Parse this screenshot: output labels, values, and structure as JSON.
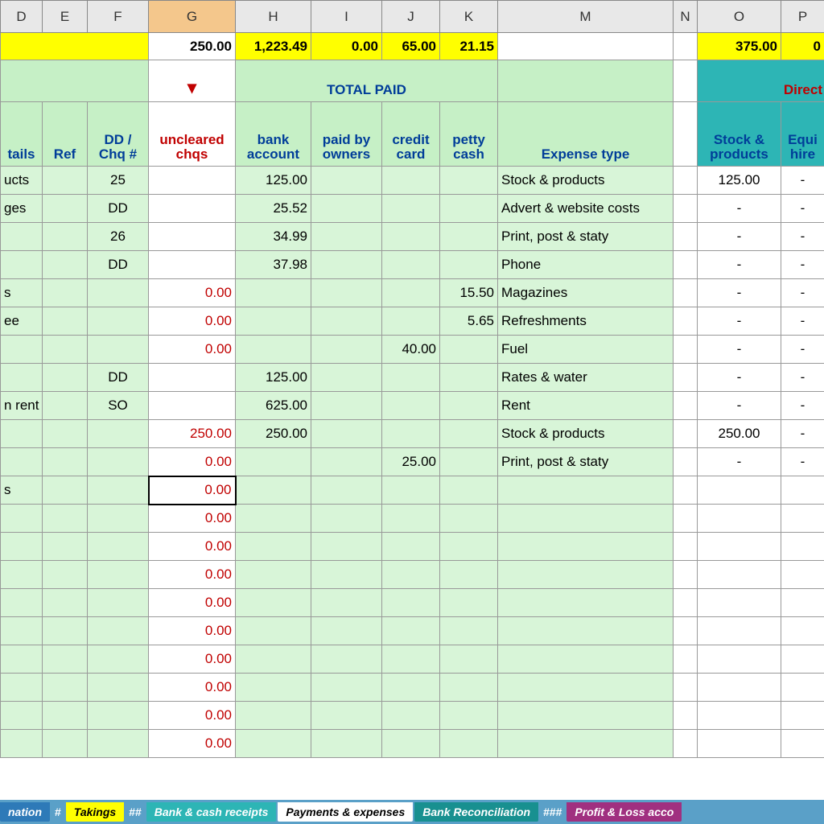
{
  "columns": [
    "D",
    "E",
    "F",
    "G",
    "H",
    "I",
    "J",
    "K",
    "M",
    "N",
    "O",
    "P"
  ],
  "totals": {
    "G": "250.00",
    "H": "1,223.49",
    "I": "0.00",
    "J": "65.00",
    "K": "21.15",
    "O": "375.00",
    "P": "0"
  },
  "section_titles": {
    "total_paid": "TOTAL PAID",
    "direct": "Direct"
  },
  "headers2": {
    "D": "tails",
    "E": "Ref",
    "F": "DD / Chq #",
    "G": "uncleared chqs",
    "H": "bank account",
    "I": "paid by owners",
    "J": "credit card",
    "K": "petty cash",
    "M": "Expense type",
    "O": "Stock & products",
    "P": "Equi hire"
  },
  "rows": [
    {
      "D": "ucts",
      "E": "",
      "F": "25",
      "G": "",
      "H": "125.00",
      "I": "",
      "J": "",
      "K": "",
      "M": "Stock & products",
      "O": "125.00",
      "P": "-"
    },
    {
      "D": "ges",
      "E": "",
      "F": "DD",
      "G": "",
      "H": "25.52",
      "I": "",
      "J": "",
      "K": "",
      "M": "Advert & website costs",
      "O": "-",
      "P": "-"
    },
    {
      "D": "",
      "E": "",
      "F": "26",
      "G": "",
      "H": "34.99",
      "I": "",
      "J": "",
      "K": "",
      "M": "Print, post & staty",
      "O": "-",
      "P": "-"
    },
    {
      "D": "",
      "E": "",
      "F": "DD",
      "G": "",
      "H": "37.98",
      "I": "",
      "J": "",
      "K": "",
      "M": "Phone",
      "O": "-",
      "P": "-"
    },
    {
      "D": "s",
      "E": "",
      "F": "",
      "G": "0.00",
      "H": "",
      "I": "",
      "J": "",
      "K": "15.50",
      "M": "Magazines",
      "O": "-",
      "P": "-"
    },
    {
      "D": "ee",
      "E": "",
      "F": "",
      "G": "0.00",
      "H": "",
      "I": "",
      "J": "",
      "K": "5.65",
      "M": "Refreshments",
      "O": "-",
      "P": "-"
    },
    {
      "D": "",
      "E": "",
      "F": "",
      "G": "0.00",
      "H": "",
      "I": "",
      "J": "40.00",
      "K": "",
      "M": "Fuel",
      "O": "-",
      "P": "-"
    },
    {
      "D": "",
      "E": "",
      "F": "DD",
      "G": "",
      "H": "125.00",
      "I": "",
      "J": "",
      "K": "",
      "M": "Rates & water",
      "O": "-",
      "P": "-"
    },
    {
      "D": "n rent",
      "E": "",
      "F": "SO",
      "G": "",
      "H": "625.00",
      "I": "",
      "J": "",
      "K": "",
      "M": "Rent",
      "O": "-",
      "P": "-"
    },
    {
      "D": "",
      "E": "",
      "F": "",
      "G": "250.00",
      "H": "250.00",
      "I": "",
      "J": "",
      "K": "",
      "M": "Stock & products",
      "O": "250.00",
      "P": "-"
    },
    {
      "D": "",
      "E": "",
      "F": "",
      "G": "0.00",
      "H": "",
      "I": "",
      "J": "25.00",
      "K": "",
      "M": "Print, post & staty",
      "O": "-",
      "P": "-"
    },
    {
      "D": "s",
      "E": "",
      "F": "",
      "G": "0.00",
      "H": "",
      "I": "",
      "J": "",
      "K": "",
      "M": "",
      "O": "",
      "P": "",
      "selected": true
    },
    {
      "D": "",
      "E": "",
      "F": "",
      "G": "0.00",
      "H": "",
      "I": "",
      "J": "",
      "K": "",
      "M": "",
      "O": "",
      "P": ""
    },
    {
      "D": "",
      "E": "",
      "F": "",
      "G": "0.00",
      "H": "",
      "I": "",
      "J": "",
      "K": "",
      "M": "",
      "O": "",
      "P": ""
    },
    {
      "D": "",
      "E": "",
      "F": "",
      "G": "0.00",
      "H": "",
      "I": "",
      "J": "",
      "K": "",
      "M": "",
      "O": "",
      "P": ""
    },
    {
      "D": "",
      "E": "",
      "F": "",
      "G": "0.00",
      "H": "",
      "I": "",
      "J": "",
      "K": "",
      "M": "",
      "O": "",
      "P": ""
    },
    {
      "D": "",
      "E": "",
      "F": "",
      "G": "0.00",
      "H": "",
      "I": "",
      "J": "",
      "K": "",
      "M": "",
      "O": "",
      "P": ""
    },
    {
      "D": "",
      "E": "",
      "F": "",
      "G": "0.00",
      "H": "",
      "I": "",
      "J": "",
      "K": "",
      "M": "",
      "O": "",
      "P": ""
    },
    {
      "D": "",
      "E": "",
      "F": "",
      "G": "0.00",
      "H": "",
      "I": "",
      "J": "",
      "K": "",
      "M": "",
      "O": "",
      "P": ""
    },
    {
      "D": "",
      "E": "",
      "F": "",
      "G": "0.00",
      "H": "",
      "I": "",
      "J": "",
      "K": "",
      "M": "",
      "O": "",
      "P": ""
    },
    {
      "D": "",
      "E": "",
      "F": "",
      "G": "0.00",
      "H": "",
      "I": "",
      "J": "",
      "K": "",
      "M": "",
      "O": "",
      "P": ""
    }
  ],
  "tabs": [
    {
      "label": "nation",
      "cls": "blue"
    },
    {
      "label": "#",
      "cls": "hash"
    },
    {
      "label": "Takings",
      "cls": "yellow"
    },
    {
      "label": "##",
      "cls": "hash"
    },
    {
      "label": "Bank & cash receipts",
      "cls": "teal1"
    },
    {
      "label": "Payments & expenses",
      "cls": "active"
    },
    {
      "label": "Bank Reconciliation",
      "cls": "teal2"
    },
    {
      "label": "###",
      "cls": "hash"
    },
    {
      "label": "Profit & Loss acco",
      "cls": "purple"
    }
  ]
}
